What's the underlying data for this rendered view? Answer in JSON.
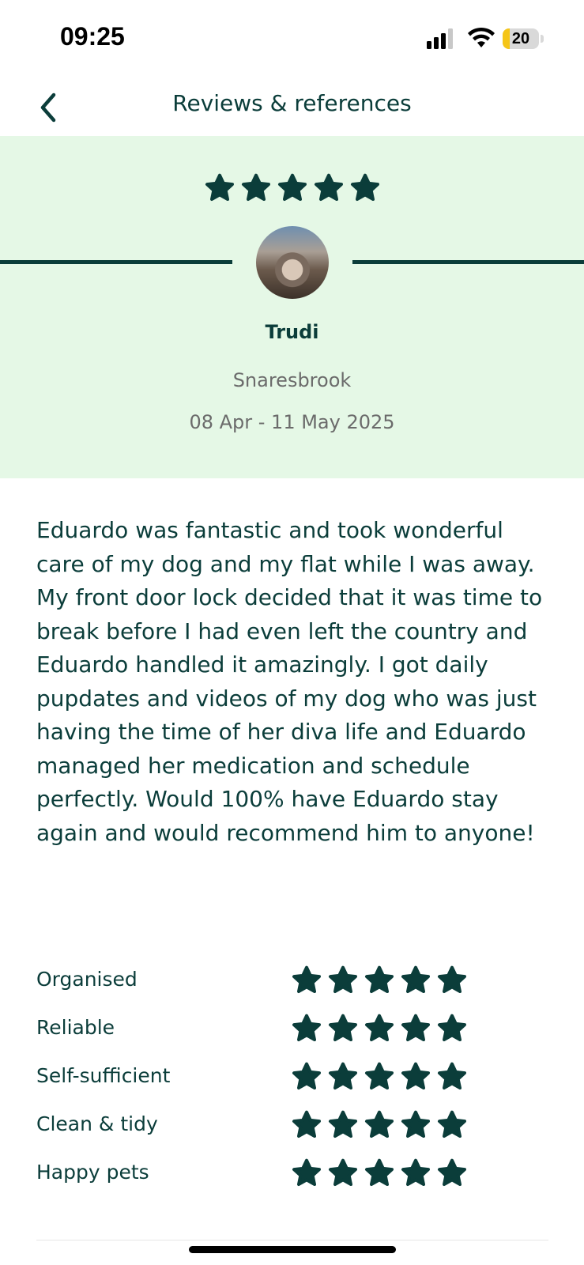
{
  "status_bar": {
    "time": "09:25",
    "battery_level": "20",
    "battery_fraction": 0.2,
    "battery_color": "#f5c518",
    "icons": [
      "cellular-signal-icon",
      "wifi-icon",
      "battery-icon"
    ]
  },
  "nav": {
    "back_icon": "chevron-left-icon",
    "title": "Reviews & references"
  },
  "review": {
    "overall_rating": 5,
    "rating_max": 5,
    "reviewer_name": "Trudi",
    "location": "Snaresbrook",
    "dates": "08 Apr - 11 May 2025",
    "text": "Eduardo was fantastic and took wonderful care of my dog and my flat while I was away. My front door lock decided that it was time to break before I had even left the country and Eduardo handled it amazingly. I got daily pupdates and videos of my dog who was just having the time of her diva life and Eduardo managed her medication and schedule perfectly. Would 100% have Eduardo stay again and would recommend him to anyone!",
    "categories": [
      {
        "label": "Organised",
        "rating": 5
      },
      {
        "label": "Reliable",
        "rating": 5
      },
      {
        "label": "Self-sufficient",
        "rating": 5
      },
      {
        "label": "Clean & tidy",
        "rating": 5
      },
      {
        "label": "Happy pets",
        "rating": 5
      }
    ]
  },
  "colors": {
    "primary": "#0b3d3a",
    "header_background": "#e5f8e6",
    "muted_text": "#6b6b6b"
  }
}
